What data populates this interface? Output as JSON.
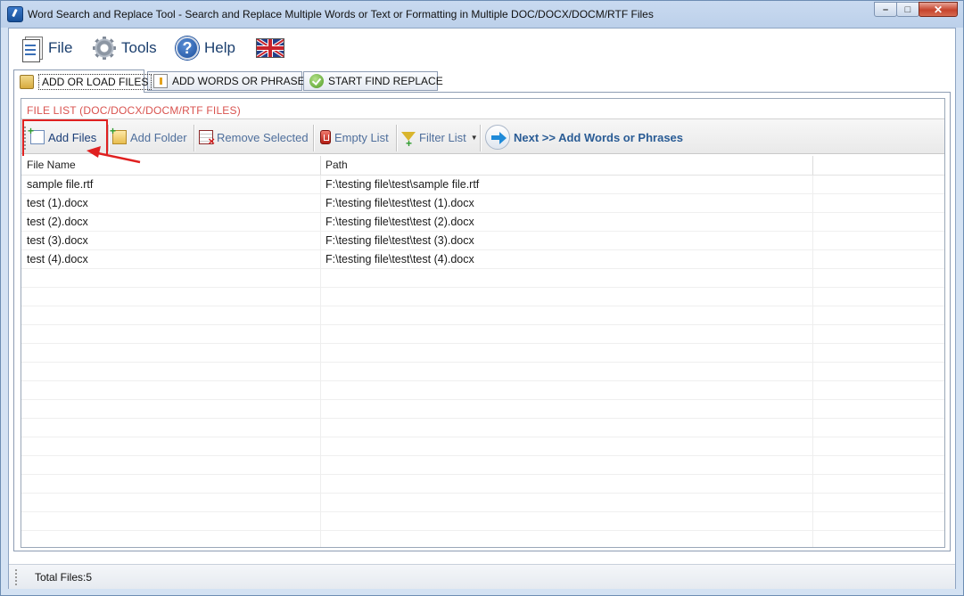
{
  "window": {
    "title": "Word Search and Replace Tool - Search and Replace Multiple Words or Text  or Formatting in Multiple DOC/DOCX/DOCM/RTF Files",
    "controls": {
      "minimize": "–",
      "maximize": "□",
      "close": "✕"
    }
  },
  "menu": {
    "file": "File",
    "tools": "Tools",
    "help": "Help",
    "language_icon": "uk-flag-icon"
  },
  "tabs": [
    {
      "label": "ADD OR LOAD FILES",
      "active": true,
      "icon": "folder-icon"
    },
    {
      "label": "ADD WORDS OR PHRASES",
      "active": false,
      "icon": "document-icon"
    },
    {
      "label": "START FIND REPLACE",
      "active": false,
      "icon": "check-icon"
    }
  ],
  "file_list": {
    "title": "FILE LIST (DOC/DOCX/DOCM/RTF FILES)",
    "toolbar": {
      "add_files": "Add Files",
      "add_folder": "Add Folder",
      "remove_selected": "Remove Selected",
      "empty_list": "Empty List",
      "filter_list": "Filter List",
      "next": "Next >> Add Words or Phrases"
    },
    "columns": {
      "name": "File Name",
      "path": "Path"
    },
    "rows": [
      {
        "name": "sample file.rtf",
        "path": "F:\\testing file\\test\\sample file.rtf"
      },
      {
        "name": "test (1).docx",
        "path": "F:\\testing file\\test\\test (1).docx"
      },
      {
        "name": "test (2).docx",
        "path": "F:\\testing file\\test\\test (2).docx"
      },
      {
        "name": "test (3).docx",
        "path": "F:\\testing file\\test\\test (3).docx"
      },
      {
        "name": "test (4).docx",
        "path": "F:\\testing file\\test\\test (4).docx"
      }
    ]
  },
  "status": {
    "total_files": "Total Files:5"
  },
  "colors": {
    "section_title": "#d9534f",
    "highlight": "#e02020",
    "accent": "#1f8ad8"
  }
}
